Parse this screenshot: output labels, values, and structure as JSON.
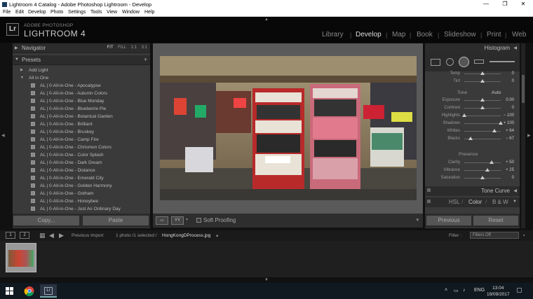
{
  "window": {
    "title": "Lightroom 4 Catalog - Adobe Photoshop Lightroom - Develop",
    "minimize": "—",
    "maximize": "❐",
    "close": "✕"
  },
  "menu": [
    "File",
    "Edit",
    "Develop",
    "Photo",
    "Settings",
    "Tools",
    "View",
    "Window",
    "Help"
  ],
  "identity": {
    "logo": "Lr",
    "vendor": "ADOBE PHOTOSHOP",
    "product": "LIGHTROOM 4"
  },
  "modules": [
    {
      "label": "Library",
      "active": false
    },
    {
      "label": "Develop",
      "active": true
    },
    {
      "label": "Map",
      "active": false
    },
    {
      "label": "Book",
      "active": false
    },
    {
      "label": "Slideshow",
      "active": false
    },
    {
      "label": "Print",
      "active": false
    },
    {
      "label": "Web",
      "active": false
    }
  ],
  "navigator": {
    "title": "Navigator",
    "zoom_options": [
      "FIT",
      "FILL",
      "1:1",
      "3:1"
    ],
    "selected_zoom": "FIT"
  },
  "presets": {
    "title": "Presets",
    "add": "+",
    "folders": [
      "Add Light",
      "All in One"
    ],
    "items": [
      "AL | 0-All-in-One - Apocalypse",
      "AL | 0-All-in-One - Autumn Colors",
      "AL | 0-All-in-One - Blue Monday",
      "AL | 0-All-in-One - Blueberrie Pie",
      "AL | 0-All-in-One - Botanical Garden",
      "AL | 0-All-in-One - Brilliant",
      "AL | 0-All-in-One - Bruskey",
      "AL | 0-All-in-One - Camp Fire",
      "AL | 0-All-in-One - Chrismon Colors",
      "AL | 0-All-in-One - Color Splash",
      "AL | 0-All-in-One - Dark Dream",
      "AL | 0-All-in-One - Distance",
      "AL | 0-All-in-One - Emerald City",
      "AL | 0-All-in-One - Golden Harmony",
      "AL | 0-All-in-One - Gotham",
      "AL | 0-All-in-One - Honeybee",
      "AL | 0-All-in-One - Just An Ordinary Day"
    ]
  },
  "left_buttons": {
    "copy": "Copy...",
    "paste": "Paste"
  },
  "toolbar": {
    "soft_proofing": "Soft Proofing",
    "view_icon": "▭",
    "compare_icon": "YY"
  },
  "right": {
    "histogram": "Histogram",
    "sliders_top": [
      {
        "label": "Temp",
        "value": "0",
        "pos": 0.5
      },
      {
        "label": "Tint",
        "value": "0",
        "pos": 0.5
      }
    ],
    "tone_label": "Tone",
    "auto_label": "Auto",
    "tone_sliders": [
      {
        "label": "Exposure",
        "value": "0.00",
        "pos": 0.5
      },
      {
        "label": "Contrast",
        "value": "0",
        "pos": 0.5
      },
      {
        "label": "Highlights",
        "value": "− 100",
        "pos": 0.0
      },
      {
        "label": "Shadows",
        "value": "+ 100",
        "pos": 1.0
      },
      {
        "label": "Whites",
        "value": "+ 64",
        "pos": 0.82
      },
      {
        "label": "Blacks",
        "value": "− 67",
        "pos": 0.17
      }
    ],
    "presence_label": "Presence",
    "presence_sliders": [
      {
        "label": "Clarity",
        "value": "+ 50",
        "pos": 0.75
      },
      {
        "label": "Vibrance",
        "value": "+ 25",
        "pos": 0.63
      },
      {
        "label": "Saturation",
        "value": "0",
        "pos": 0.5
      }
    ],
    "tone_curve": "Tone Curve",
    "hsl": [
      "HSL",
      "Color",
      "B & W"
    ],
    "previous": "Previous",
    "reset": "Reset"
  },
  "filmstrip_bar": {
    "page1": "1",
    "page2": "2",
    "previous_import": "Previous Import",
    "status": "1 photo /1 selected /",
    "filename": "HongKongDProcess.jpg",
    "filter_label": "Filter :",
    "filter_value": "Filters Off"
  },
  "taskbar": {
    "time": "13:04",
    "date": "19/09/2017",
    "lang": "ENG"
  }
}
